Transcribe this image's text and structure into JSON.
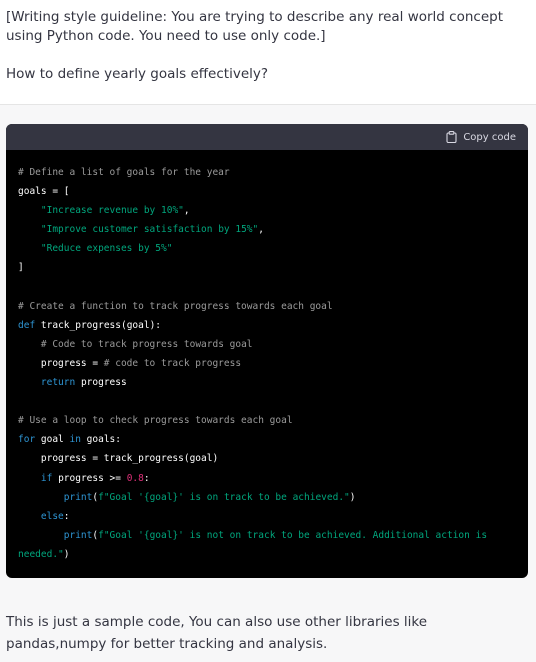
{
  "user_message": {
    "guideline": "[Writing style guideline: You are trying to describe any real world concept using Python code. You need to use only code.]",
    "question": "How to define yearly goals effectively?"
  },
  "code_block": {
    "copy_label": "Copy code",
    "copy_icon": "clipboard-icon",
    "colors": {
      "background": "#000000",
      "header": "#343541",
      "comment": "#9b9b9b",
      "string": "#00a67d",
      "keyword": "#2e95d3",
      "function": "#f22c3d",
      "number": "#df3079"
    },
    "lines": [
      [
        {
          "t": "comment",
          "v": "# Define a list of goals for the year"
        }
      ],
      [
        {
          "t": "plain",
          "v": "goals = ["
        }
      ],
      [
        {
          "t": "plain",
          "v": "    "
        },
        {
          "t": "string",
          "v": "\"Increase revenue by 10%\""
        },
        {
          "t": "plain",
          "v": ","
        }
      ],
      [
        {
          "t": "plain",
          "v": "    "
        },
        {
          "t": "string",
          "v": "\"Improve customer satisfaction by 15%\""
        },
        {
          "t": "plain",
          "v": ","
        }
      ],
      [
        {
          "t": "plain",
          "v": "    "
        },
        {
          "t": "string",
          "v": "\"Reduce expenses by 5%\""
        }
      ],
      [
        {
          "t": "plain",
          "v": "]"
        }
      ],
      [],
      [
        {
          "t": "comment",
          "v": "# Create a function to track progress towards each goal"
        }
      ],
      [
        {
          "t": "keyword",
          "v": "def"
        },
        {
          "t": "plain",
          "v": " "
        },
        {
          "t": "function",
          "v": "track_progress"
        },
        {
          "t": "plain",
          "v": "(goal):"
        }
      ],
      [
        {
          "t": "plain",
          "v": "    "
        },
        {
          "t": "comment",
          "v": "# Code to track progress towards goal"
        }
      ],
      [
        {
          "t": "plain",
          "v": "    progress = "
        },
        {
          "t": "comment",
          "v": "# code to track progress"
        }
      ],
      [
        {
          "t": "plain",
          "v": "    "
        },
        {
          "t": "keyword",
          "v": "return"
        },
        {
          "t": "plain",
          "v": " progress"
        }
      ],
      [],
      [
        {
          "t": "comment",
          "v": "# Use a loop to check progress towards each goal"
        }
      ],
      [
        {
          "t": "keyword",
          "v": "for"
        },
        {
          "t": "plain",
          "v": " goal "
        },
        {
          "t": "keyword",
          "v": "in"
        },
        {
          "t": "plain",
          "v": " goals:"
        }
      ],
      [
        {
          "t": "plain",
          "v": "    progress = track_progress(goal)"
        }
      ],
      [
        {
          "t": "plain",
          "v": "    "
        },
        {
          "t": "keyword",
          "v": "if"
        },
        {
          "t": "plain",
          "v": " progress >= "
        },
        {
          "t": "number",
          "v": "0.8"
        },
        {
          "t": "plain",
          "v": ":"
        }
      ],
      [
        {
          "t": "plain",
          "v": "        "
        },
        {
          "t": "keyword",
          "v": "print"
        },
        {
          "t": "plain",
          "v": "("
        },
        {
          "t": "string",
          "v": "f\"Goal '{goal}' is on track to be achieved.\""
        },
        {
          "t": "plain",
          "v": ")"
        }
      ],
      [
        {
          "t": "plain",
          "v": "    "
        },
        {
          "t": "keyword",
          "v": "else"
        },
        {
          "t": "plain",
          "v": ":"
        }
      ],
      [
        {
          "t": "plain",
          "v": "        "
        },
        {
          "t": "keyword",
          "v": "print"
        },
        {
          "t": "plain",
          "v": "("
        },
        {
          "t": "string",
          "v": "f\"Goal '{goal}' is not on track to be achieved. Additional action is needed.\""
        },
        {
          "t": "plain",
          "v": ")"
        }
      ]
    ]
  },
  "answer": {
    "text": "This is just a sample code, You can also use other libraries like pandas,numpy for better tracking and analysis."
  }
}
